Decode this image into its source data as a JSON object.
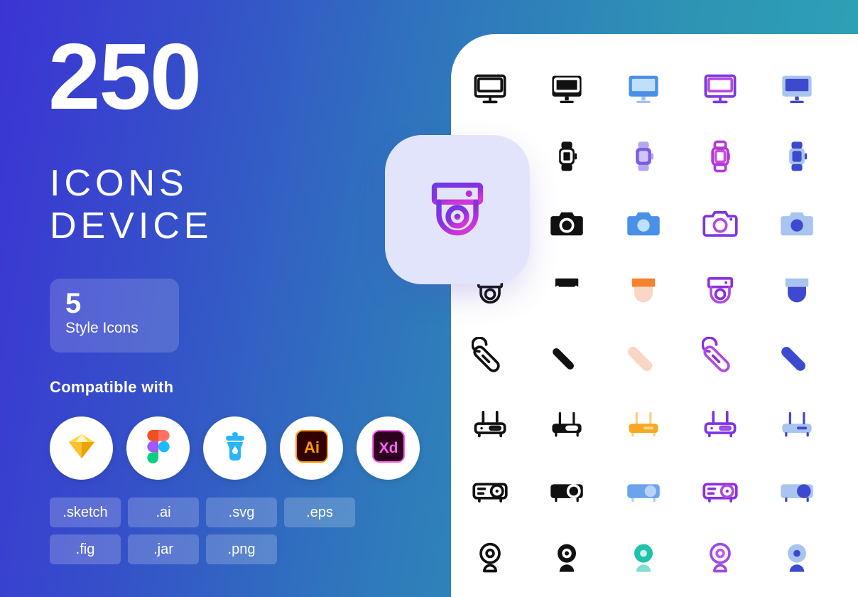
{
  "theme": {
    "gradient_start": "#3b34d4",
    "gradient_end": "#2ba8b6",
    "panel_bg": "#ffffff",
    "card_bg": "#e2e4fb",
    "accent_purple": "#7b36e0",
    "accent_magenta": "#c033d8",
    "accent_blue": "#4a90e8",
    "accent_orange": "#f6812f",
    "accent_amber": "#f7a823",
    "accent_teal": "#1fc2ab",
    "accent_indigo": "#3d49cf",
    "accent_light_blue": "#a9c4ef",
    "black": "#111111"
  },
  "hero": {
    "count": "250",
    "title_line_1": "ICONS",
    "title_line_2": "DEVICE"
  },
  "style_box": {
    "number": "5",
    "label": "Style Icons"
  },
  "compatible": {
    "heading": "Compatible with",
    "apps": [
      {
        "name": "Sketch",
        "icon": "sketch-icon"
      },
      {
        "name": "Figma",
        "icon": "figma-icon"
      },
      {
        "name": "Jar",
        "icon": "jar-icon"
      },
      {
        "name": "Adobe Illustrator",
        "icon": "adobe-illustrator-icon",
        "label": "Ai"
      },
      {
        "name": "Adobe XD",
        "icon": "adobe-xd-icon",
        "label": "Xd"
      }
    ]
  },
  "formats": {
    "row_1": [
      ".sketch",
      ".ai",
      ".svg",
      ".eps"
    ],
    "row_2": [
      ".fig",
      ".jar",
      ".png"
    ]
  },
  "featured": {
    "icon": "cctv-dome-camera-icon",
    "style": "gradient-outline"
  },
  "icon_grid": {
    "columns": 5,
    "column_styles": [
      "outline",
      "solid",
      "flat-color",
      "duotone-outline",
      "duotone-fill"
    ],
    "rows": [
      {
        "name": "monitor",
        "icons": [
          "monitor-outline-icon",
          "monitor-solid-icon",
          "monitor-flat-icon",
          "monitor-duotone-outline-icon",
          "monitor-duotone-fill-icon"
        ]
      },
      {
        "name": "smartwatch",
        "icons": [
          "smartwatch-outline-icon",
          "smartwatch-solid-icon",
          "smartwatch-flat-icon",
          "smartwatch-duotone-outline-icon",
          "smartwatch-duotone-fill-icon"
        ]
      },
      {
        "name": "camera",
        "icons": [
          "camera-outline-icon",
          "camera-solid-icon",
          "camera-flat-icon",
          "camera-duotone-outline-icon",
          "camera-duotone-fill-icon"
        ]
      },
      {
        "name": "cctv-dome-camera",
        "icons": [
          "cctv-outline-icon",
          "cctv-solid-icon",
          "cctv-flat-icon",
          "cctv-duotone-outline-icon",
          "cctv-duotone-fill-icon"
        ]
      },
      {
        "name": "computer-mouse",
        "icons": [
          "mouse-outline-icon",
          "mouse-solid-icon",
          "mouse-flat-icon",
          "mouse-duotone-outline-icon",
          "mouse-duotone-fill-icon"
        ]
      },
      {
        "name": "wifi-router",
        "icons": [
          "router-outline-icon",
          "router-solid-icon",
          "router-flat-icon",
          "router-duotone-outline-icon",
          "router-duotone-fill-icon"
        ]
      },
      {
        "name": "projector",
        "icons": [
          "projector-outline-icon",
          "projector-solid-icon",
          "projector-flat-icon",
          "projector-duotone-outline-icon",
          "projector-duotone-fill-icon"
        ]
      },
      {
        "name": "webcam",
        "icons": [
          "webcam-outline-icon",
          "webcam-solid-icon",
          "webcam-flat-icon",
          "webcam-duotone-outline-icon",
          "webcam-duotone-fill-icon"
        ]
      }
    ]
  }
}
